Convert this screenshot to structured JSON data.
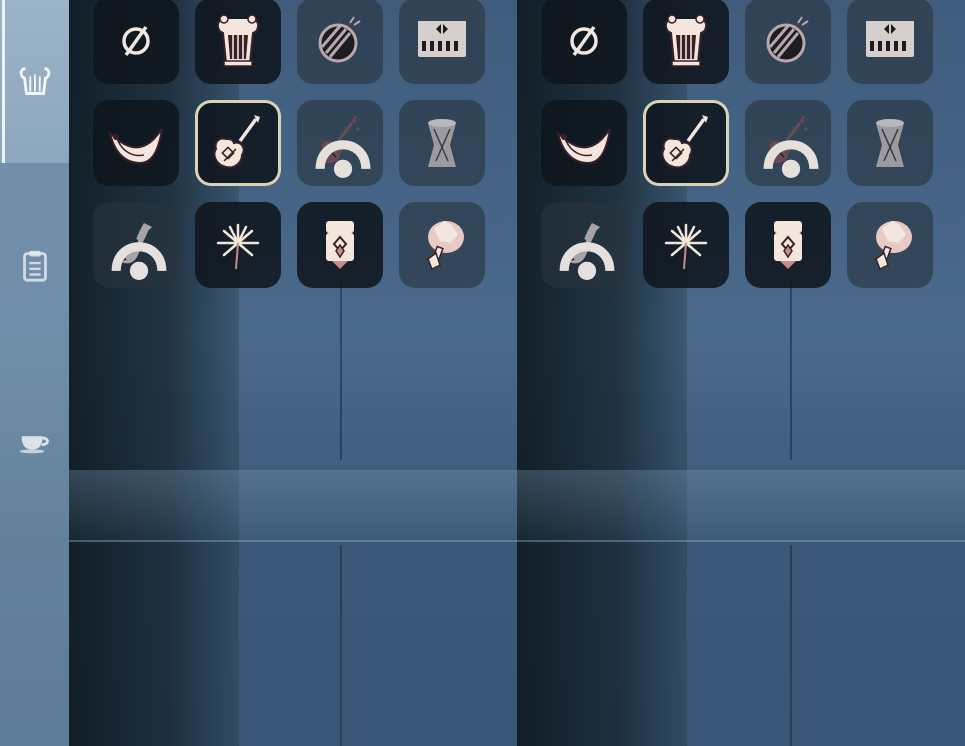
{
  "sidebar": {
    "tabs": [
      {
        "name": "instruments-tab",
        "icon": "lyre-icon",
        "active": true
      },
      {
        "name": "props-tab",
        "icon": "clipboard-icon",
        "active": false
      },
      {
        "name": "consumables-tab",
        "icon": "teacup-icon",
        "active": false
      }
    ]
  },
  "panels": [
    {
      "id": "left",
      "slots": [
        {
          "icon": "none-icon",
          "state": "normal"
        },
        {
          "icon": "lyre-icon",
          "state": "normal"
        },
        {
          "icon": "drum-icon",
          "state": "locked"
        },
        {
          "icon": "piano-icon",
          "state": "locked"
        },
        {
          "icon": "horn-icon",
          "state": "normal"
        },
        {
          "icon": "guitar-icon",
          "state": "selected"
        },
        {
          "icon": "violin-icon",
          "state": "locked"
        },
        {
          "icon": "hand-drum-icon",
          "state": "locked"
        },
        {
          "icon": "saxophone-icon",
          "state": "locked"
        },
        {
          "icon": "firework-icon",
          "state": "normal"
        },
        {
          "icon": "ornament-icon",
          "state": "normal"
        },
        {
          "icon": "fan-icon",
          "state": "locked"
        }
      ]
    },
    {
      "id": "right",
      "slots": [
        {
          "icon": "none-icon",
          "state": "normal"
        },
        {
          "icon": "lyre-icon",
          "state": "normal"
        },
        {
          "icon": "drum-icon",
          "state": "locked"
        },
        {
          "icon": "piano-icon",
          "state": "locked"
        },
        {
          "icon": "horn-icon",
          "state": "normal"
        },
        {
          "icon": "guitar-icon",
          "state": "selected"
        },
        {
          "icon": "violin-icon",
          "state": "locked"
        },
        {
          "icon": "hand-drum-icon",
          "state": "locked"
        },
        {
          "icon": "saxophone-icon",
          "state": "locked"
        },
        {
          "icon": "firework-icon",
          "state": "normal"
        },
        {
          "icon": "ornament-icon",
          "state": "normal"
        },
        {
          "icon": "fan-icon",
          "state": "locked"
        }
      ]
    }
  ],
  "colors": {
    "icon_cream": "#f3e6dc",
    "icon_outline": "#3a1f2a",
    "accent_pink": "#c98a8a",
    "selected_border": "#d9d4b8"
  }
}
